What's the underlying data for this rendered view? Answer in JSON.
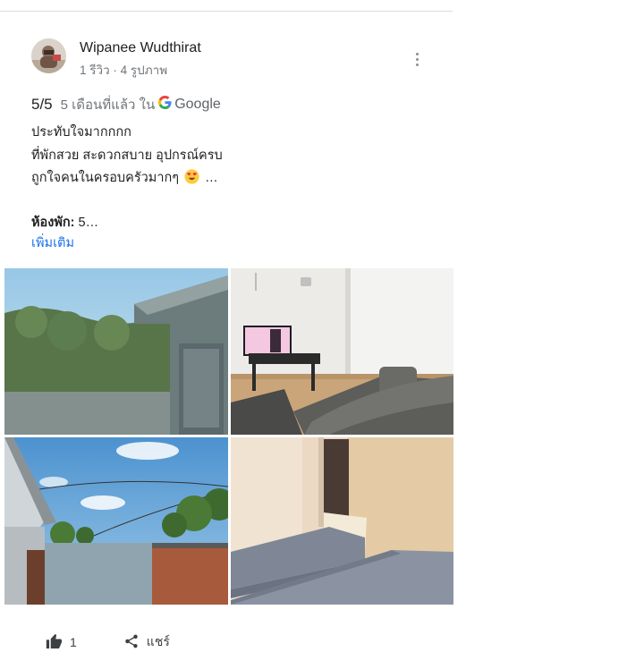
{
  "review": {
    "author_name": "Wipanee Wudthirat",
    "author_meta": "1 รีวิว · 4 รูปภาพ",
    "rating": "5/5",
    "time_ago": "5 เดือนที่แล้ว ใน",
    "source": "Google",
    "lines": [
      "ประทับใจมากกกก",
      "ที่พักสวย สะดวกสบาย อุปกรณ์ครบ",
      "ถูกใจคนในครอบครัวมากๆ"
    ],
    "line3_suffix": " …",
    "room_label": "ห้องพัก:",
    "room_value": " 5…",
    "more_link": "เพิ่มเติม",
    "photos": [
      "outdoor-patio-photo",
      "living-room-photo",
      "backyard-photo",
      "bedroom-photo"
    ],
    "like_count": "1",
    "share_label": "แชร์"
  },
  "colors": {
    "link": "#1a73e8",
    "secondary_text": "#70757a",
    "divider": "#dadce0"
  }
}
